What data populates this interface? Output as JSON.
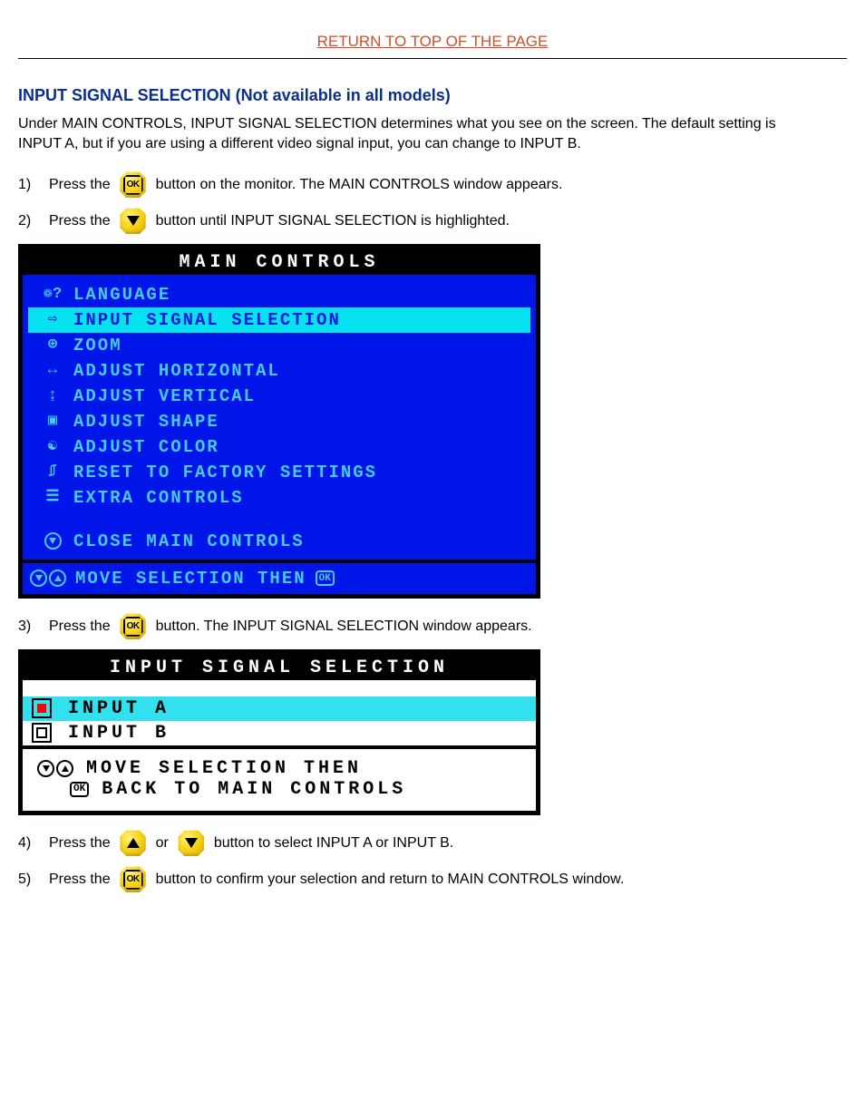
{
  "top_link": "RETURN TO TOP OF THE PAGE",
  "section_title": "INPUT SIGNAL SELECTION (Not available in all models)",
  "intro": "Under MAIN CONTROLS, INPUT SIGNAL SELECTION determines what you see on the screen. The default setting is INPUT A, but if you are using a different video signal input, you can change to INPUT B.",
  "steps": {
    "s1": {
      "num": "1)",
      "pre": "Press the",
      "post": "button on the monitor. The MAIN CONTROLS window appears."
    },
    "s2": {
      "num": "2)",
      "pre": "Press the",
      "post": "button until INPUT SIGNAL SELECTION is highlighted."
    },
    "s3": {
      "num": "3)",
      "pre": "Press the",
      "post": "button. The INPUT SIGNAL SELECTION window appears."
    },
    "s4": {
      "num": "4)",
      "pre": "Press the",
      "mid": "or",
      "post": "button to select INPUT A or INPUT B."
    },
    "s5": {
      "num": "5)",
      "pre": "Press the",
      "post": "button to confirm your selection and return to MAIN CONTROLS window."
    }
  },
  "main_controls": {
    "title": "MAIN CONTROLS",
    "items": [
      {
        "icon": "language-icon",
        "glyph": "❁?",
        "label": "LANGUAGE"
      },
      {
        "icon": "input-signal-icon",
        "glyph": "⇨",
        "label": "INPUT SIGNAL SELECTION",
        "selected": true
      },
      {
        "icon": "zoom-icon",
        "glyph": "⊕",
        "label": "ZOOM"
      },
      {
        "icon": "adjust-horizontal-icon",
        "glyph": "↔",
        "label": "ADJUST HORIZONTAL"
      },
      {
        "icon": "adjust-vertical-icon",
        "glyph": "↨",
        "label": "ADJUST VERTICAL"
      },
      {
        "icon": "adjust-shape-icon",
        "glyph": "▣",
        "label": "ADJUST SHAPE"
      },
      {
        "icon": "adjust-color-icon",
        "glyph": "☯",
        "label": "ADJUST COLOR"
      },
      {
        "icon": "factory-reset-icon",
        "glyph": "⎎",
        "label": "RESET TO FACTORY SETTINGS"
      },
      {
        "icon": "extra-controls-icon",
        "glyph": "☰",
        "label": "EXTRA CONTROLS"
      }
    ],
    "close": {
      "icon": "close-down-icon",
      "label": "CLOSE MAIN CONTROLS"
    },
    "footer": "MOVE SELECTION THEN",
    "footer_ok": "OK"
  },
  "input_signal": {
    "title": "INPUT SIGNAL SELECTION",
    "options": [
      {
        "label": "INPUT A",
        "selected": true
      },
      {
        "label": "INPUT B",
        "selected": false
      }
    ],
    "footer_line1": "MOVE SELECTION THEN",
    "footer_line2": "BACK TO MAIN CONTROLS",
    "ok": "OK"
  }
}
